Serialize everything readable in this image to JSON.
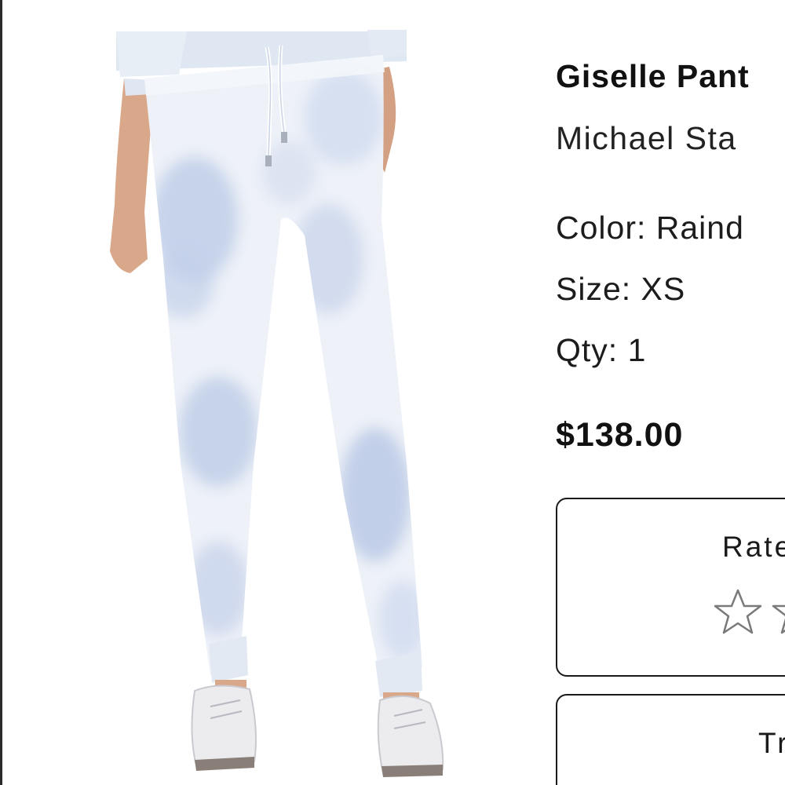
{
  "product": {
    "name": "Giselle Pant",
    "brand": "Michael Sta",
    "color_text": "Color: Raind",
    "size_text": "Size: XS",
    "qty_text": "Qty: 1",
    "price": "$138.00",
    "image_icon": "product-photo-pants"
  },
  "rating": {
    "title": "Rate",
    "stars": 0,
    "star_icon": "star-outline-icon"
  },
  "button": {
    "label": "Tr"
  },
  "colors": {
    "text": "#111111",
    "card_border": "#1a1a1a",
    "pant_base": "#eef2f8",
    "pant_dye": "#b9c8e6",
    "shoe": "#e9e9ec",
    "skin": "#d9a88a"
  }
}
